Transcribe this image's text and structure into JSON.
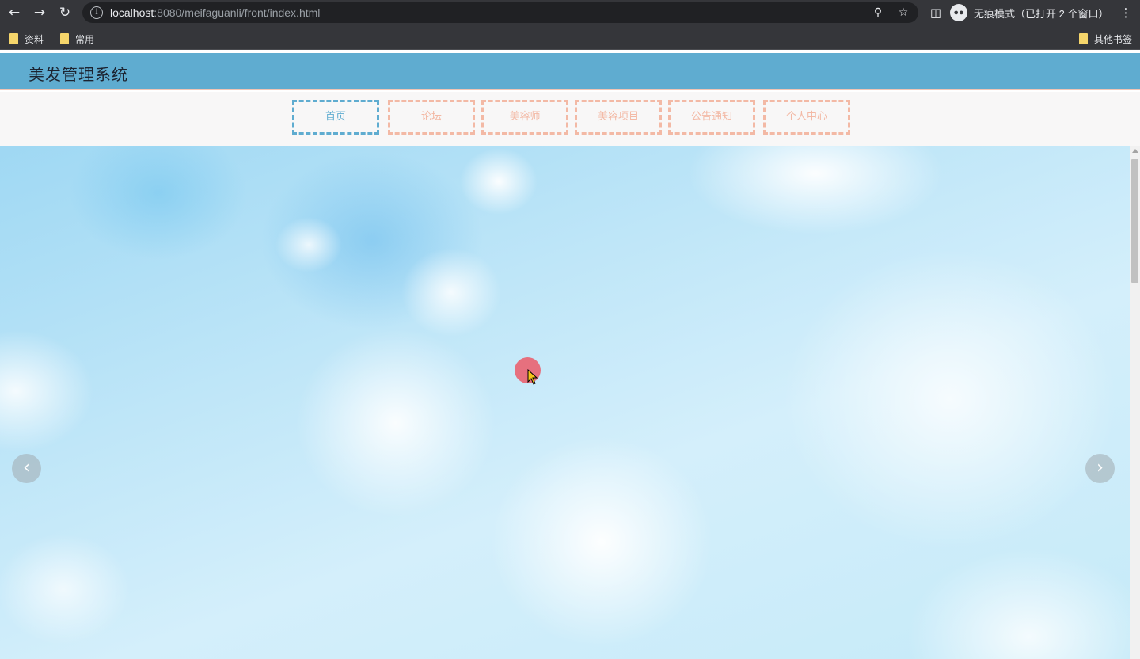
{
  "browser": {
    "url_host": "localhost",
    "url_rest": ":8080/meifaguanli/front/index.html",
    "incognito_label": "无痕模式（已打开 2 个窗口）",
    "bookmarks": [
      "资料",
      "常用"
    ],
    "other_bookmarks": "其他书签"
  },
  "site": {
    "title": "美发管理系统",
    "nav": [
      "首页",
      "论坛",
      "美容师",
      "美容项目",
      "公告通知",
      "个人中心"
    ],
    "active_nav": "首页"
  },
  "banner": {
    "prev_icon": "chevron-left-icon",
    "next_icon": "chevron-right-icon"
  },
  "colors": {
    "header": "#5facd0",
    "nav_inactive": "#f3b9a5",
    "nav_active": "#5facd0"
  }
}
